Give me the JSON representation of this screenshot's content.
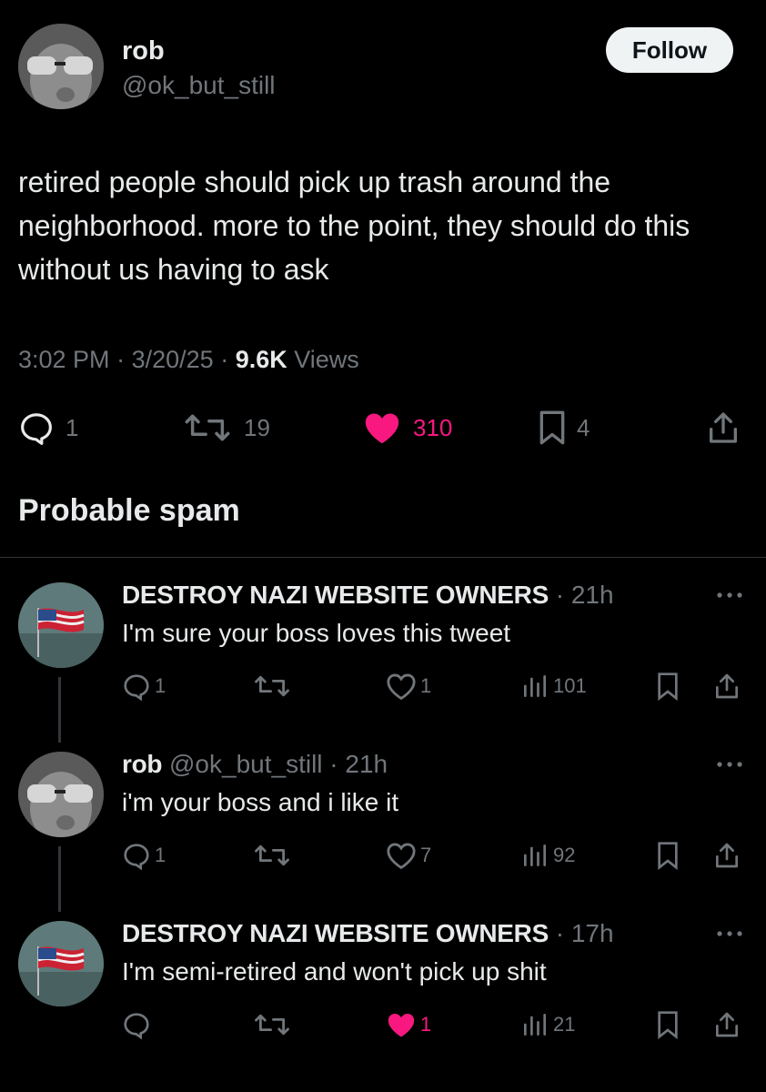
{
  "post": {
    "author_name": "rob",
    "author_handle": "@ok_but_still",
    "follow_label": "Follow",
    "text": "retired people should pick up trash around the neighborhood. more to the point, they should do this without us having to ask",
    "time": "3:02 PM",
    "date": "3/20/25",
    "views_count": "9.6K",
    "views_label": "Views",
    "replies": "1",
    "reposts": "19",
    "likes": "310",
    "bookmarks": "4",
    "liked": true
  },
  "section_title": "Probable spam",
  "replies": [
    {
      "name": "DESTROY NAZI WEBSITE OWNERS",
      "handle": "",
      "time": "21h",
      "text": "I'm sure your boss loves this tweet",
      "replies": "1",
      "reposts": "",
      "likes": "1",
      "views": "101",
      "liked": false
    },
    {
      "name": "rob",
      "handle": "@ok_but_still",
      "time": "21h",
      "text": "i'm your boss and i like it",
      "replies": "1",
      "reposts": "",
      "likes": "7",
      "views": "92",
      "liked": false
    },
    {
      "name": "DESTROY NAZI WEBSITE OWNERS",
      "handle": "",
      "time": "17h",
      "text": "I'm semi-retired and won't pick up shit",
      "replies": "",
      "reposts": "",
      "likes": "1",
      "views": "21",
      "liked": true
    }
  ],
  "colors": {
    "background": "#000000",
    "text": "#e7e9ea",
    "muted": "#71767b",
    "like_pink": "#f91880",
    "divider": "#2f3336"
  },
  "icons": [
    "reply-icon",
    "repost-icon",
    "heart-icon",
    "bookmark-icon",
    "share-icon",
    "views-icon",
    "more-icon"
  ]
}
